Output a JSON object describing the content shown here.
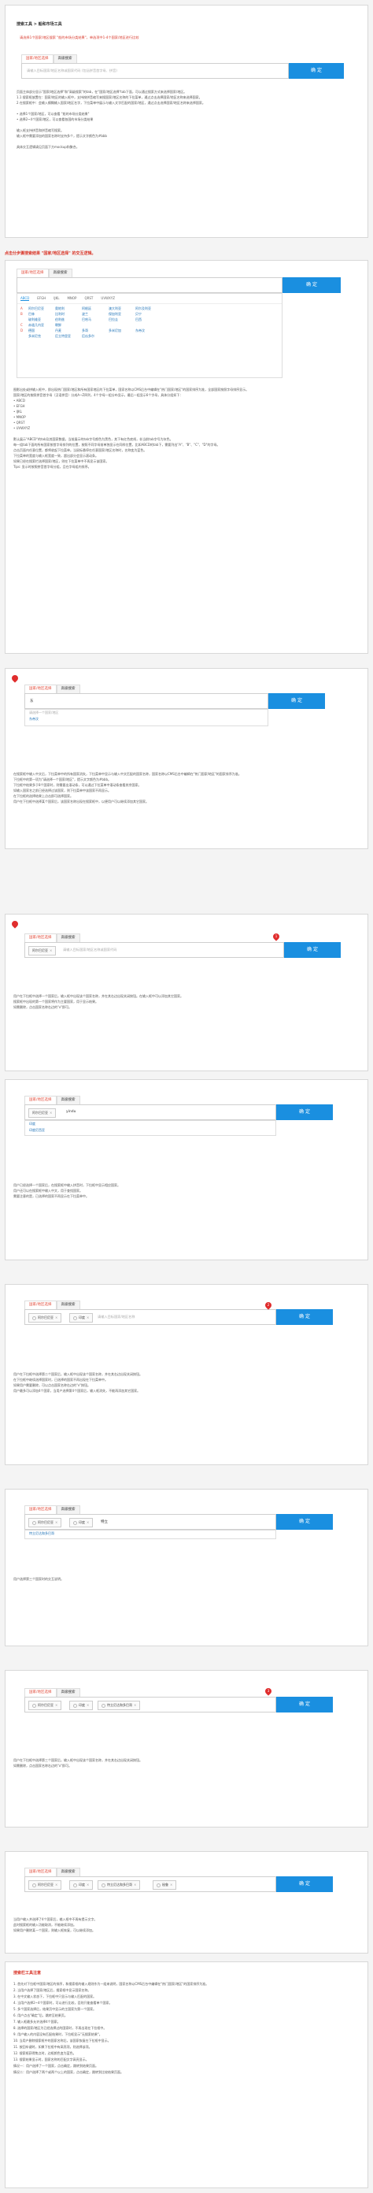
{
  "brief": {
    "title": "搜索工具 > 船和市场工具",
    "note": "请选择1个国家/地区搜索 \"船的市场分类结果\"，单选项中1-4个国家/地区进行比较",
    "tabs": [
      "国家/地区选择",
      "高级搜索"
    ],
    "placeholder": "请输入目标国家/地区名称或国家代码 (包括拼音首字母、拼音)",
    "confirm": "确 定",
    "lines": [
      "页面主体部分显示\"国家/地区选择\"和\"高级搜索\"的tab，在\"国家/地区选择\"tab下面，可以通过搜索方式来选择国家/地区。",
      "1.1 搜索框放置在：国家/地区的输入框中，支持按拼音缩写来搜国家/地区名称的下拉菜单，通过点击选择国家/地区名称来选择国家。",
      "2 在搜索框中：会输入模糊输入国家/地区名字，下拉菜单中展示与输入文字匹配的国家/地区，通过点击选择国家/地区名称来选择国家。",
      "",
      "• 选择1个国家/地区，可以查看 \"船的市场分类结果\"",
      "• 选择2~4个国家/地区，可以查看各国的市场分类结果",
      "",
      "输入框支持拼音和拼音缩写搜索。",
      "输入框中需要添加的国家名称时支持多个，提示文字颜色为#bbb",
      "",
      "具体交互逻辑请见页面下方mockup和聚合。"
    ]
  },
  "s1": {
    "heading": "点击分步骤搜索结果 \"国家/地区选择\" 的交互逻辑。",
    "tabs": [
      "国家/地区选择",
      "高级搜索"
    ],
    "confirm": "确 定",
    "letters": [
      "ABCD",
      "EFGH",
      "IJKL",
      "MNOP",
      "QRST",
      "UVWXYZ"
    ],
    "rows": [
      {
        "l": "A",
        "c": [
          "阿尔巴尼亚",
          "奥地利",
          "阿根廷",
          "澳大利亚",
          "阿尔及利亚"
        ]
      },
      {
        "l": "B",
        "c": [
          "巴林",
          "比利时",
          "波兰",
          "保加利亚",
          "贝宁"
        ]
      },
      {
        "l": "",
        "c": [
          "玻利维亚",
          "伯利兹",
          "巴哈马",
          "巴拉圭",
          "巴西"
        ]
      },
      {
        "l": "C",
        "c": [
          "赤道几内亚",
          "朝鲜",
          "",
          "",
          ""
        ]
      },
      {
        "l": "D",
        "c": [
          "德国",
          "丹麦",
          "多哥",
          "多米尼加",
          "东帝汶"
        ]
      },
      {
        "l": "",
        "c": [
          "多米尼克",
          "厄立特里亚",
          "厄瓜多尔",
          "",
          ""
        ]
      }
    ],
    "lines": [
      "图影出处或拼输入框中，即出现热门国家/地区和所有国家地区的下拉菜单，国家名称以CMS后台中编辑在\"热门国家/地区\"的国家排序为准，全部国家按照字母排序显示。",
      "国家/地区的按照拼音首字母（汉语拼音）分成A~Z四列，4个字母一组分布显示，最后一组显示6个字母，具体分组如下：",
      "• ABCD",
      "• EFGH",
      "• IJKL",
      "• MNOP",
      "• QRST",
      "• UVWXYZ",
      "",
      "默认展示\"ABCD\"的tab及其国家数据，当前展示的tab字号颜色为黑色，其下有红色底线，非当前tab字号为灰色。",
      "每一组tab下面的所有国家按首字母排列的位置，按照不同字母前单独显示在同样位置，比如ABCD的tab下，需要列出\"A\"、\"B\"、\"C\"、\"D\"的字母。",
      "点击页面内任意位置，都将收起下拉菜单。当鼠标悬停在任意国家/地区名称时，名称变为蓝色。",
      "下拉菜单的宽度与输入框宽度一致，超出部分会显示滚动条。",
      "如果已经在搜索栏选择国家/地区，则在下拉菜单中不再显示该国家。",
      "Tips: 显示时按照拼音首字母分组，且在字母组内排序。"
    ]
  },
  "s2": {
    "tabs": [
      "国家/地区选择",
      "高级搜索"
    ],
    "confirm": "确 定",
    "typed": "东",
    "suggestions": [
      "请选择一个国家/地区",
      "东帝汶"
    ],
    "lines": [
      "在搜索框中输入中文后，下拉菜单中的所有国家消失，下拉菜单中显示与输入中文匹配的国家名称，国家名称以CMS后台中编辑在\"热门国家/地区\"的国家排序为准。",
      "下拉框中的第一项为\"请选择一个国家/地区\"，提示文字颜色为#bbb。",
      "下拉框中结果多于8个国家时，则需要出滚动条，可以通过下拉菜单中滚动条查看其余国家。",
      "如输入国家名之前已经选择过该国家，则下拉菜单中该国家不再显示。",
      "在下拉框的选择结果上点击即可选择国家。",
      "用户在下拉框中选择某个国家后，该国家名称出现在搜索框中，以便用户可以继续添加其它国家。"
    ]
  },
  "s3": {
    "tabs": [
      "国家/地区选择",
      "高级搜索"
    ],
    "confirm": "确 定",
    "chips": [
      "阿尔巴尼亚"
    ],
    "placeholder": "请输入目标国家/地区名称或国家代码",
    "pin": "1",
    "lines": [
      "用户在下拉框中选择一个国家后，输入框中出现该个国家名称，并在其右边出现关闭按钮。在输入框中可以添加其它国家。",
      "搜索框中出现的第一个国家将作为主要国家，用于显示结果。",
      "如需删除，点击国家名称右边的\"x\"即可。"
    ]
  },
  "s4": {
    "tabs": [
      "国家/地区选择",
      "高级搜索"
    ],
    "confirm": "确 定",
    "chips": [
      "阿尔巴尼亚"
    ],
    "typed": "yindu",
    "suggestions": [
      "印度",
      "印度尼西亚"
    ],
    "lines": [
      "用户已经选择一个国家后，在搜索框中输入拼音时，下拉框中显示相应国家。",
      "用户还可以在搜索框中输入中文，用于查找国家。",
      "需要注意的是，已选择的国家不再显示在下拉菜单中。"
    ]
  },
  "s5": {
    "tabs": [
      "国家/地区选择",
      "高级搜索"
    ],
    "confirm": "确 定",
    "chips": [
      "阿尔巴尼亚",
      "印度"
    ],
    "placeholder": "请输入目标国家/地区名称",
    "pin": "2",
    "lines": [
      "用户在下拉框中选择第二个国家后，输入框中出现该个国家名称，并在其右边出现关闭按钮。",
      "在下拉框中继续选择国家时，已选择的国家不再出现在下拉菜单中。",
      "如果用户需要删除，可以点击国家名称右边的\"x\"按钮。",
      "用户最多可以添加4个国家，当用户选择第4个国家后，输入框消失，不能再添加其它国家。"
    ]
  },
  "s6": {
    "tabs": [
      "国家/地区选择",
      "高级搜索"
    ],
    "confirm": "确 定",
    "chips": [
      "阿尔巴尼亚",
      "印度"
    ],
    "typed": "特立",
    "suggestions": [
      "特立尼达和多巴哥"
    ],
    "lines": [
      "用户选择第三个国家时的交互说明。"
    ]
  },
  "s7": {
    "tabs": [
      "国家/地区选择",
      "高级搜索"
    ],
    "confirm": "确 定",
    "chips": [
      "阿尔巴尼亚",
      "印度",
      "特立尼达和多巴哥"
    ],
    "pin": "3",
    "lines": [
      "用户在下拉框中选择第三个国家后，输入框中出现该个国家名称，并在其右边出现关闭按钮。",
      "如需删除，点击国家名称右边的\"x\"即可。"
    ]
  },
  "s8": {
    "tabs": [
      "国家/地区选择",
      "高级搜索"
    ],
    "confirm": "确 定",
    "chips": [
      "阿尔巴尼亚",
      "印度",
      "特立尼达和多巴哥",
      "秘鲁"
    ],
    "lines": [
      "当用户输入并选择了4个国家后，输入框中不再有提示文字。",
      "此时搜索框的输入功能取消，不能继续添加。",
      "如果用户删除某一个国家，则输入框恢复，可以继续添加。"
    ]
  },
  "notes": {
    "heading": "搜索栏工具注意",
    "lines": [
      "1. 首先对下拉框中国家/地区的排序，和搜索框的输入规则作为一组来说明，国家名称以CMS后台中编辑在\"热门国家/地区\"的国家排序为准。",
      "2. 当用户选择了国家/地区后，搜索框中显示国家名称。",
      "3. 在中文输入状态下，下拉框中只显示与输入匹配的国家。",
      "4. 当用户选择2~4个国家时，可以进行比较，否则只能查看单个国家。",
      "5. 多个国家选择后，结果页中显示的主国家为第一个国家。",
      "6. 用户点击\"确定\"后，跳转至结果页。",
      "7. 输入框最多允许选择4个国家。",
      "8. 选择的国家/地区为已经选择过的国家时，不再出现在下拉框中。",
      "9. 用户输入的内容没有匹配结果时，下拉框显示\"无搜索结果\"。",
      "10. 当用户删除搜索框中的国家名称后，该国家恢复在下拉框中显示。",
      "11. 按回车键时，如果下拉框中有高亮项，则选择该项。",
      "12. 搜索框获得焦点时，边框颜色变为蓝色。",
      "13. 搜索结果显示时，国家名称的匹配文字高亮显示。",
      "情况一：用户选择了一个国家，点击确定，跳转到结果页面。",
      "情况二：用户选择了两个或两个以上的国家，点击确定，跳转到比较结果页面。"
    ]
  }
}
